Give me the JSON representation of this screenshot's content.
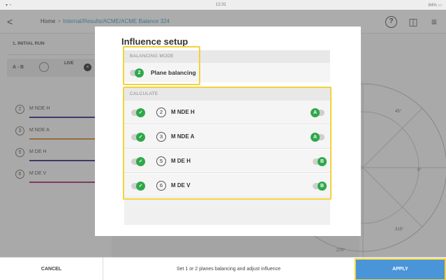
{
  "status_bar": {
    "left": "▾ ◔",
    "time": "12:31",
    "battery": "84% ▭"
  },
  "header": {
    "back_glyph": "<",
    "breadcrumb": {
      "home": "Home",
      "sep": ">",
      "path": "Internal/Results/ACME/ACME Balance 324"
    },
    "help_glyph": "?",
    "camera_glyph": "◫",
    "menu_glyph": "≡"
  },
  "background": {
    "run_title": "1. INITIAL RUN",
    "ab_label": "A - B",
    "live_label": "LIVE",
    "measurements": [
      {
        "num": "2",
        "label": "M NDE H",
        "color": "#3a2f86"
      },
      {
        "num": "3",
        "label": "M NDE A",
        "color": "#d98a3a"
      },
      {
        "num": "5",
        "label": "M DE H",
        "color": "#3a2f86"
      },
      {
        "num": "6",
        "label": "M DE V",
        "color": "#b03070"
      }
    ],
    "plot_labels": {
      "a45": "45°",
      "a0": "0°",
      "a315": "315°",
      "a270": "270°"
    }
  },
  "dialog": {
    "title": "Influence setup",
    "balancing_mode": {
      "header": "BALANCING MODE",
      "value_badge": "2",
      "label": "Plane balancing"
    },
    "calculate": {
      "header": "CALCULATE",
      "rows": [
        {
          "num": "2",
          "name": "M NDE H",
          "plane": "A"
        },
        {
          "num": "3",
          "name": "M NDE A",
          "plane": "A"
        },
        {
          "num": "5",
          "name": "M DE H",
          "plane": "B"
        },
        {
          "num": "6",
          "name": "M DE V",
          "plane": "B"
        }
      ]
    },
    "check_glyph": "✓"
  },
  "footer": {
    "cancel": "CANCEL",
    "hint": "Set 1 or 2 planes balancing and adjust influence",
    "apply": "APPLY"
  },
  "colors": {
    "accent_green": "#2ea84a",
    "highlight": "#f3d23c",
    "apply_blue": "#4a94d8"
  }
}
